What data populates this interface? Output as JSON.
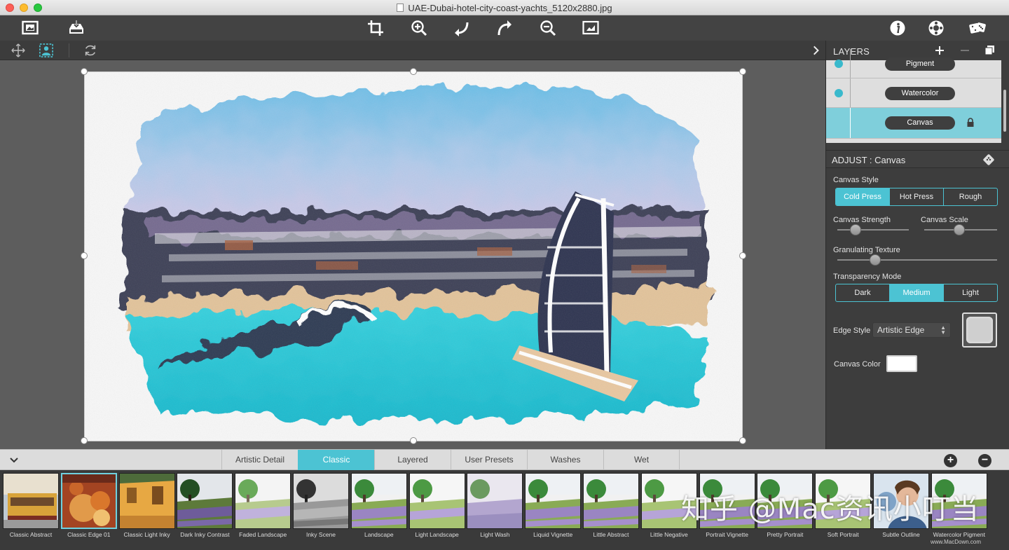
{
  "window": {
    "title": "UAE-Dubai-hotel-city-coast-yachts_5120x2880.jpg"
  },
  "toolbar": {
    "left_icons": [
      "open-image-icon",
      "save-icon"
    ],
    "center_icons": [
      "crop-icon",
      "zoom-in-icon",
      "rotate-left-icon",
      "rotate-right-icon",
      "zoom-out-icon",
      "fit-image-icon"
    ],
    "right_icons": [
      "info-icon",
      "settings-icon",
      "dice-icon"
    ]
  },
  "subtoolbar": {
    "icons": [
      "move-icon",
      "select-person-icon",
      "refresh-icon",
      "chevron-right-icon"
    ]
  },
  "layers": {
    "title": "LAYERS",
    "items": [
      {
        "label": "Pigment",
        "visible": true,
        "locked": false,
        "selected": false
      },
      {
        "label": "Watercolor",
        "visible": true,
        "locked": false,
        "selected": false
      },
      {
        "label": "Canvas",
        "visible": false,
        "locked": true,
        "selected": true
      }
    ]
  },
  "adjust": {
    "title": "ADJUST : Canvas",
    "canvas_style": {
      "label": "Canvas Style",
      "options": [
        "Cold Press",
        "Hot Press",
        "Rough"
      ],
      "selected": "Cold Press"
    },
    "canvas_strength": {
      "label": "Canvas Strength",
      "value": 0.25
    },
    "canvas_scale": {
      "label": "Canvas Scale",
      "value": 0.5
    },
    "granulating_texture": {
      "label": "Granulating Texture",
      "value": 0.25
    },
    "transparency_mode": {
      "label": "Transparency Mode",
      "options": [
        "Dark",
        "Medium",
        "Light"
      ],
      "selected": "Medium"
    },
    "edge_style": {
      "label": "Edge Style",
      "value": "Artistic Edge"
    },
    "canvas_color": {
      "label": "Canvas Color",
      "value": "#ffffff"
    }
  },
  "preset_tabs": {
    "items": [
      "Artistic Detail",
      "Classic",
      "Layered",
      "User Presets",
      "Washes",
      "Wet"
    ],
    "selected": "Classic"
  },
  "presets": [
    {
      "name": "Classic Abstract",
      "kind": "tram"
    },
    {
      "name": "Classic Edge 01",
      "kind": "fruit",
      "selected": true
    },
    {
      "name": "Classic Light Inky",
      "kind": "house"
    },
    {
      "name": "Dark Inky Contrast",
      "kind": "land-dark"
    },
    {
      "name": "Faded Landscape",
      "kind": "land-faded"
    },
    {
      "name": "Inky Scene",
      "kind": "land-gray"
    },
    {
      "name": "Landscape",
      "kind": "land"
    },
    {
      "name": "Light Landscape",
      "kind": "land-light"
    },
    {
      "name": "Light Wash",
      "kind": "land-wash"
    },
    {
      "name": "Liquid Vignette",
      "kind": "land"
    },
    {
      "name": "Little Abstract",
      "kind": "land"
    },
    {
      "name": "Little Negative",
      "kind": "land-light"
    },
    {
      "name": "Portrait Vignette",
      "kind": "land"
    },
    {
      "name": "Pretty Portrait",
      "kind": "land"
    },
    {
      "name": "Soft Portrait",
      "kind": "land-light"
    },
    {
      "name": "Subtle Outline",
      "kind": "portrait"
    },
    {
      "name": "Watercolor Pigment",
      "kind": "land"
    }
  ],
  "watermark": {
    "text": "知乎 @Mac资讯小叮当",
    "site": "www.MacDown.com"
  },
  "colors": {
    "accent": "#4cc3d3",
    "toolbar": "#434343",
    "panel": "#3d3d3d"
  }
}
